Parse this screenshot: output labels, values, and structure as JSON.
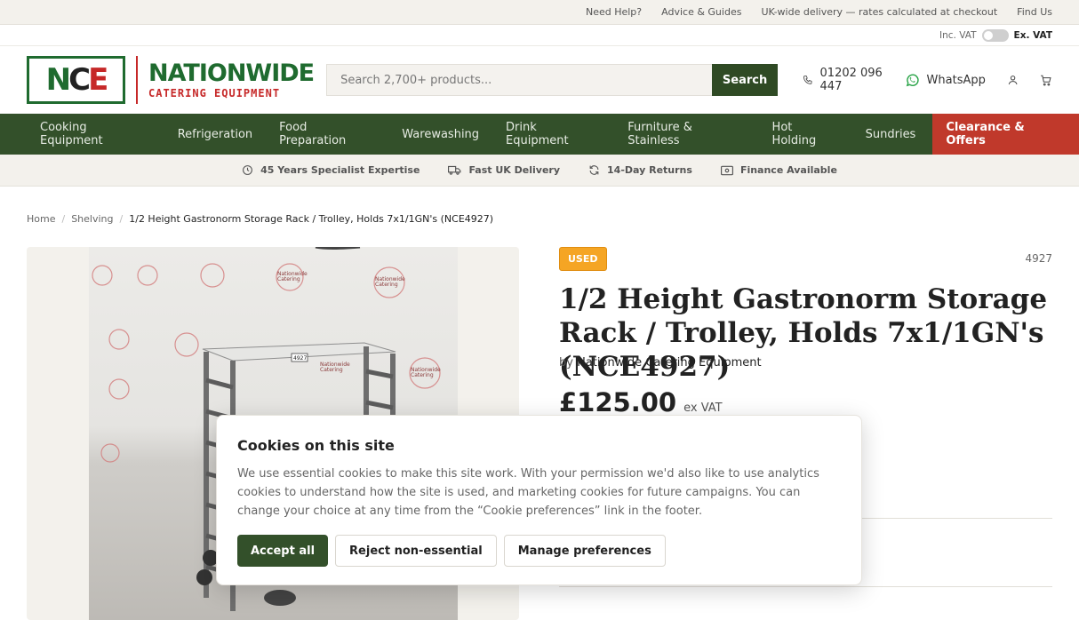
{
  "topbar": {
    "links": [
      "Need Help?",
      "Advice & Guides",
      "UK-wide delivery — rates calculated at checkout",
      "Find Us"
    ]
  },
  "vat": {
    "inc_label": "Inc. VAT",
    "ex_label": "Ex. VAT",
    "selected": "Ex. VAT"
  },
  "logo": {
    "mark": "NCE",
    "name": "NATIONWIDE",
    "tagline": "CATERING EQUIPMENT"
  },
  "search": {
    "placeholder": "Search 2,700+ products...",
    "button": "Search"
  },
  "header": {
    "phone": "01202 096 447",
    "whatsapp": "WhatsApp",
    "account_icon": "user-icon",
    "cart_icon": "cart-icon"
  },
  "nav": {
    "items": [
      "Cooking Equipment",
      "Refrigeration",
      "Food Preparation",
      "Warewashing",
      "Drink Equipment",
      "Furniture & Stainless",
      "Hot Holding",
      "Sundries"
    ],
    "highlight": "Clearance & Offers",
    "highlight_color": "#c0392b"
  },
  "usps": [
    "45 Years Specialist Expertise",
    "Fast UK Delivery",
    "14-Day Returns",
    "Finance Available"
  ],
  "breadcrumb": [
    "Home",
    "Shelving",
    "1/2 Height Gastronorm Storage Rack / Trolley, Holds 7x1/1GN's (NCE4927)"
  ],
  "product": {
    "badge": "USED",
    "badge_color": "#f5a524",
    "sku": "4927",
    "title": "1/2 Height Gastronorm Storage Rack / Trolley, Holds 7x1/1GN's (NCE4927)",
    "by_prefix": "by",
    "brand": "Nationwide Catering Equipment",
    "price": "£125.00",
    "price_suffix": "ex VAT",
    "image_tag": "4927",
    "wall_logo_text": "Nationwide Catering Equipment"
  },
  "cookie": {
    "title": "Cookies on this site",
    "body": "We use essential cookies to make this site work. With your permission we'd also like to use analytics cookies to understand how the site is used, and marketing cookies for future campaigns. You can change your choice at any time from the “Cookie preferences” link in the footer.",
    "accept": "Accept all",
    "reject": "Reject non-essential",
    "manage": "Manage preferences"
  }
}
